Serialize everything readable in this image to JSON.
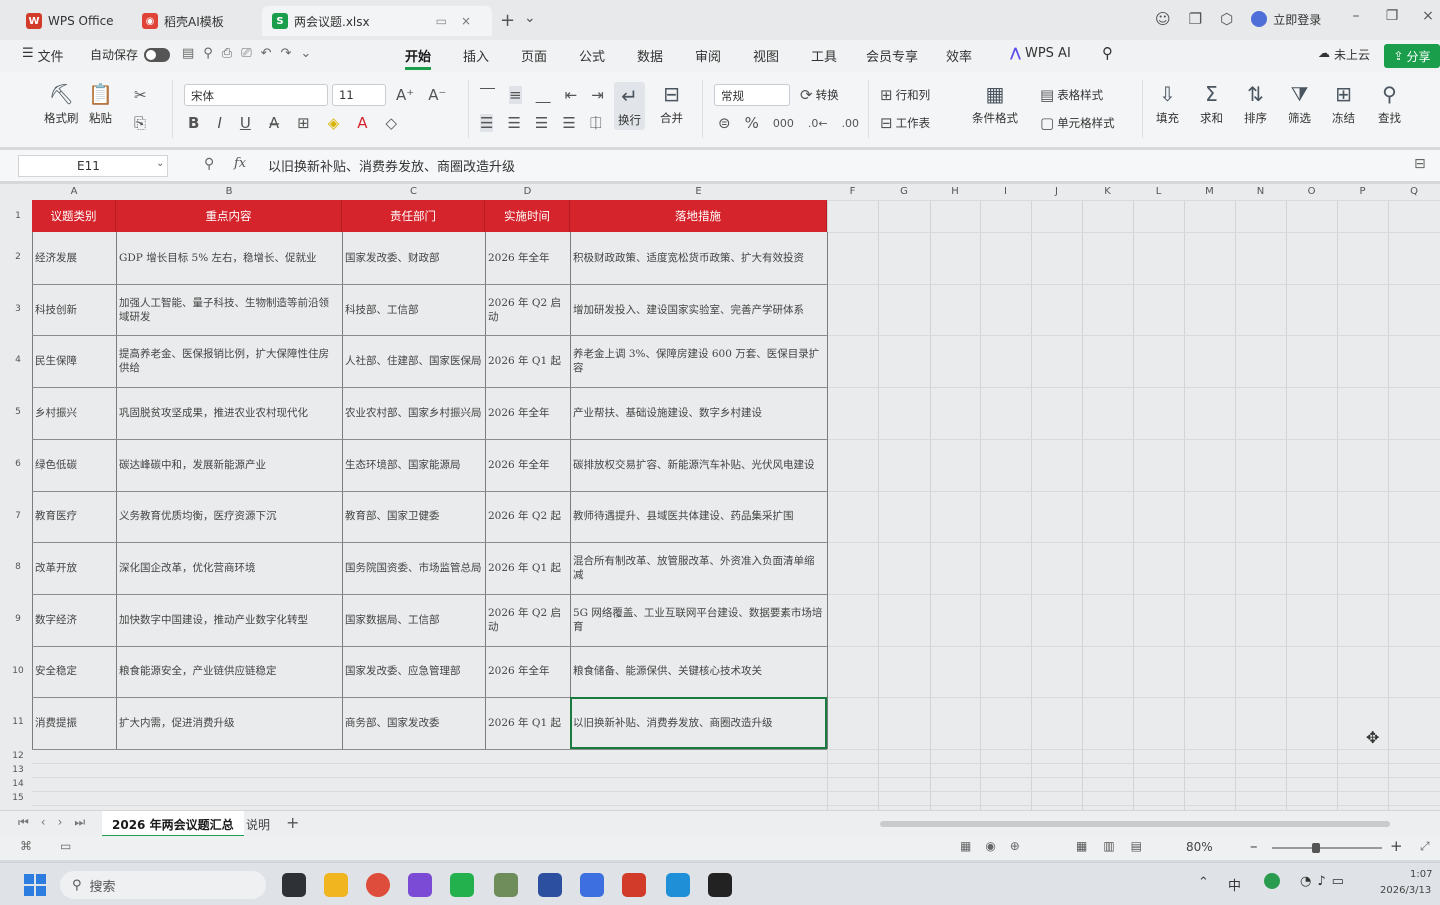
{
  "tabs": [
    {
      "label": "WPS Office",
      "color": "#d23a2a",
      "glyph": "W"
    },
    {
      "label": "稻壳AI模板",
      "color": "#e04438",
      "glyph": "◉"
    },
    {
      "label": "两会议题.xlsx",
      "color": "#1b9e4b",
      "glyph": "S"
    }
  ],
  "titlebar": {
    "login": "立即登录",
    "new_tab": "+",
    "dropdown": "⌄"
  },
  "menu": {
    "file": "文件",
    "autosave": "自动保存",
    "items": [
      "开始",
      "插入",
      "页面",
      "公式",
      "数据",
      "审阅",
      "视图",
      "工具",
      "会员专享",
      "效率",
      "WPS AI"
    ],
    "cloud": "未上云",
    "share": "分享"
  },
  "ribbon": {
    "format_painter": "格式刷",
    "paste": "粘贴",
    "font": "宋体",
    "size": "11",
    "wrap": "换行",
    "merge": "合并",
    "numfmt": "常规",
    "convert": "转换",
    "rowcol": "行和列",
    "sheet": "工作表",
    "cond_format": "条件格式",
    "table_style": "表格样式",
    "cell_style": "单元格样式",
    "fill": "填充",
    "sum": "求和",
    "sort": "排序",
    "filter": "筛选",
    "freeze": "冻结",
    "find": "查找"
  },
  "formulabar": {
    "cell": "E11",
    "fx": "fx",
    "value": "以旧换新补贴、消费券发放、商圈改造升级"
  },
  "columns": [
    "A",
    "B",
    "C",
    "D",
    "E",
    "F",
    "G",
    "H",
    "I",
    "J",
    "K",
    "L",
    "M",
    "N",
    "O",
    "P",
    "Q"
  ],
  "table": {
    "headers": [
      "议题类别",
      "重点内容",
      "责任部门",
      "实施时间",
      "落地措施"
    ],
    "rows": [
      [
        "经济发展",
        "GDP 增长目标 5% 左右，稳增长、促就业",
        "国家发改委、财政部",
        "2026 年全年",
        "积极财政政策、适度宽松货币政策、扩大有效投资"
      ],
      [
        "科技创新",
        "加强人工智能、量子科技、生物制造等前沿领域研发",
        "科技部、工信部",
        "2026 年 Q2 启动",
        "增加研发投入、建设国家实验室、完善产学研体系"
      ],
      [
        "民生保障",
        "提高养老金、医保报销比例，扩大保障性住房供给",
        "人社部、住建部、国家医保局",
        "2026 年 Q1 起",
        "养老金上调 3%、保障房建设 600 万套、医保目录扩容"
      ],
      [
        "乡村振兴",
        "巩固脱贫攻坚成果，推进农业农村现代化",
        "农业农村部、国家乡村振兴局",
        "2026 年全年",
        "产业帮扶、基础设施建设、数字乡村建设"
      ],
      [
        "绿色低碳",
        "碳达峰碳中和，发展新能源产业",
        "生态环境部、国家能源局",
        "2026 年全年",
        "碳排放权交易扩容、新能源汽车补贴、光伏风电建设"
      ],
      [
        "教育医疗",
        "义务教育优质均衡，医疗资源下沉",
        "教育部、国家卫健委",
        "2026 年 Q2 起",
        "教师待遇提升、县域医共体建设、药品集采扩围"
      ],
      [
        "改革开放",
        "深化国企改革，优化营商环境",
        "国务院国资委、市场监管总局",
        "2026 年 Q1 起",
        "混合所有制改革、放管服改革、外资准入负面清单缩减"
      ],
      [
        "数字经济",
        "加快数字中国建设，推动产业数字化转型",
        "国家数据局、工信部",
        "2026 年 Q2 启动",
        "5G 网络覆盖、工业互联网平台建设、数据要素市场培育"
      ],
      [
        "安全稳定",
        "粮食能源安全，产业链供应链稳定",
        "国家发改委、应急管理部",
        "2026 年全年",
        "粮食储备、能源保供、关键核心技术攻关"
      ],
      [
        "消费提振",
        "扩大内需，促进消费升级",
        "商务部、国家发改委",
        "2026 年 Q1 起",
        "以旧换新补贴、消费券发放、商圈改造升级"
      ]
    ]
  },
  "row_numbers": [
    "1",
    "2",
    "3",
    "4",
    "5",
    "6",
    "7",
    "8",
    "9",
    "10",
    "11",
    "12",
    "13",
    "14",
    "15"
  ],
  "sheets": {
    "active": "2026 年两会议题汇总",
    "other": "说明",
    "add": "+"
  },
  "status": {
    "zoom": "80%"
  },
  "taskbar": {
    "search": "搜索",
    "ime": "中",
    "time": "1:07",
    "date": "2026/3/13"
  }
}
